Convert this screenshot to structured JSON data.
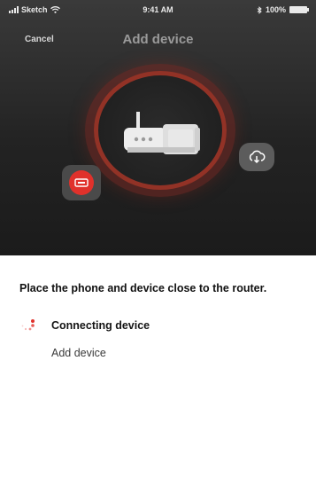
{
  "status_bar": {
    "carrier": "Sketch",
    "time": "9:41 AM",
    "battery": "100%"
  },
  "nav": {
    "cancel_label": "Cancel",
    "title": "Add device"
  },
  "icons": {
    "router": "router-icon",
    "left_device": "device-icon",
    "right_cloud": "cloud-download-icon",
    "spinner": "loading-spinner-icon"
  },
  "colors": {
    "accent_red": "#e0312b",
    "ring": "#b03a2c",
    "header_bg": "#232323"
  },
  "content": {
    "instruction": "Place the phone and device close to the router.",
    "step_title": "Connecting device",
    "step_subtitle": "Add device"
  }
}
